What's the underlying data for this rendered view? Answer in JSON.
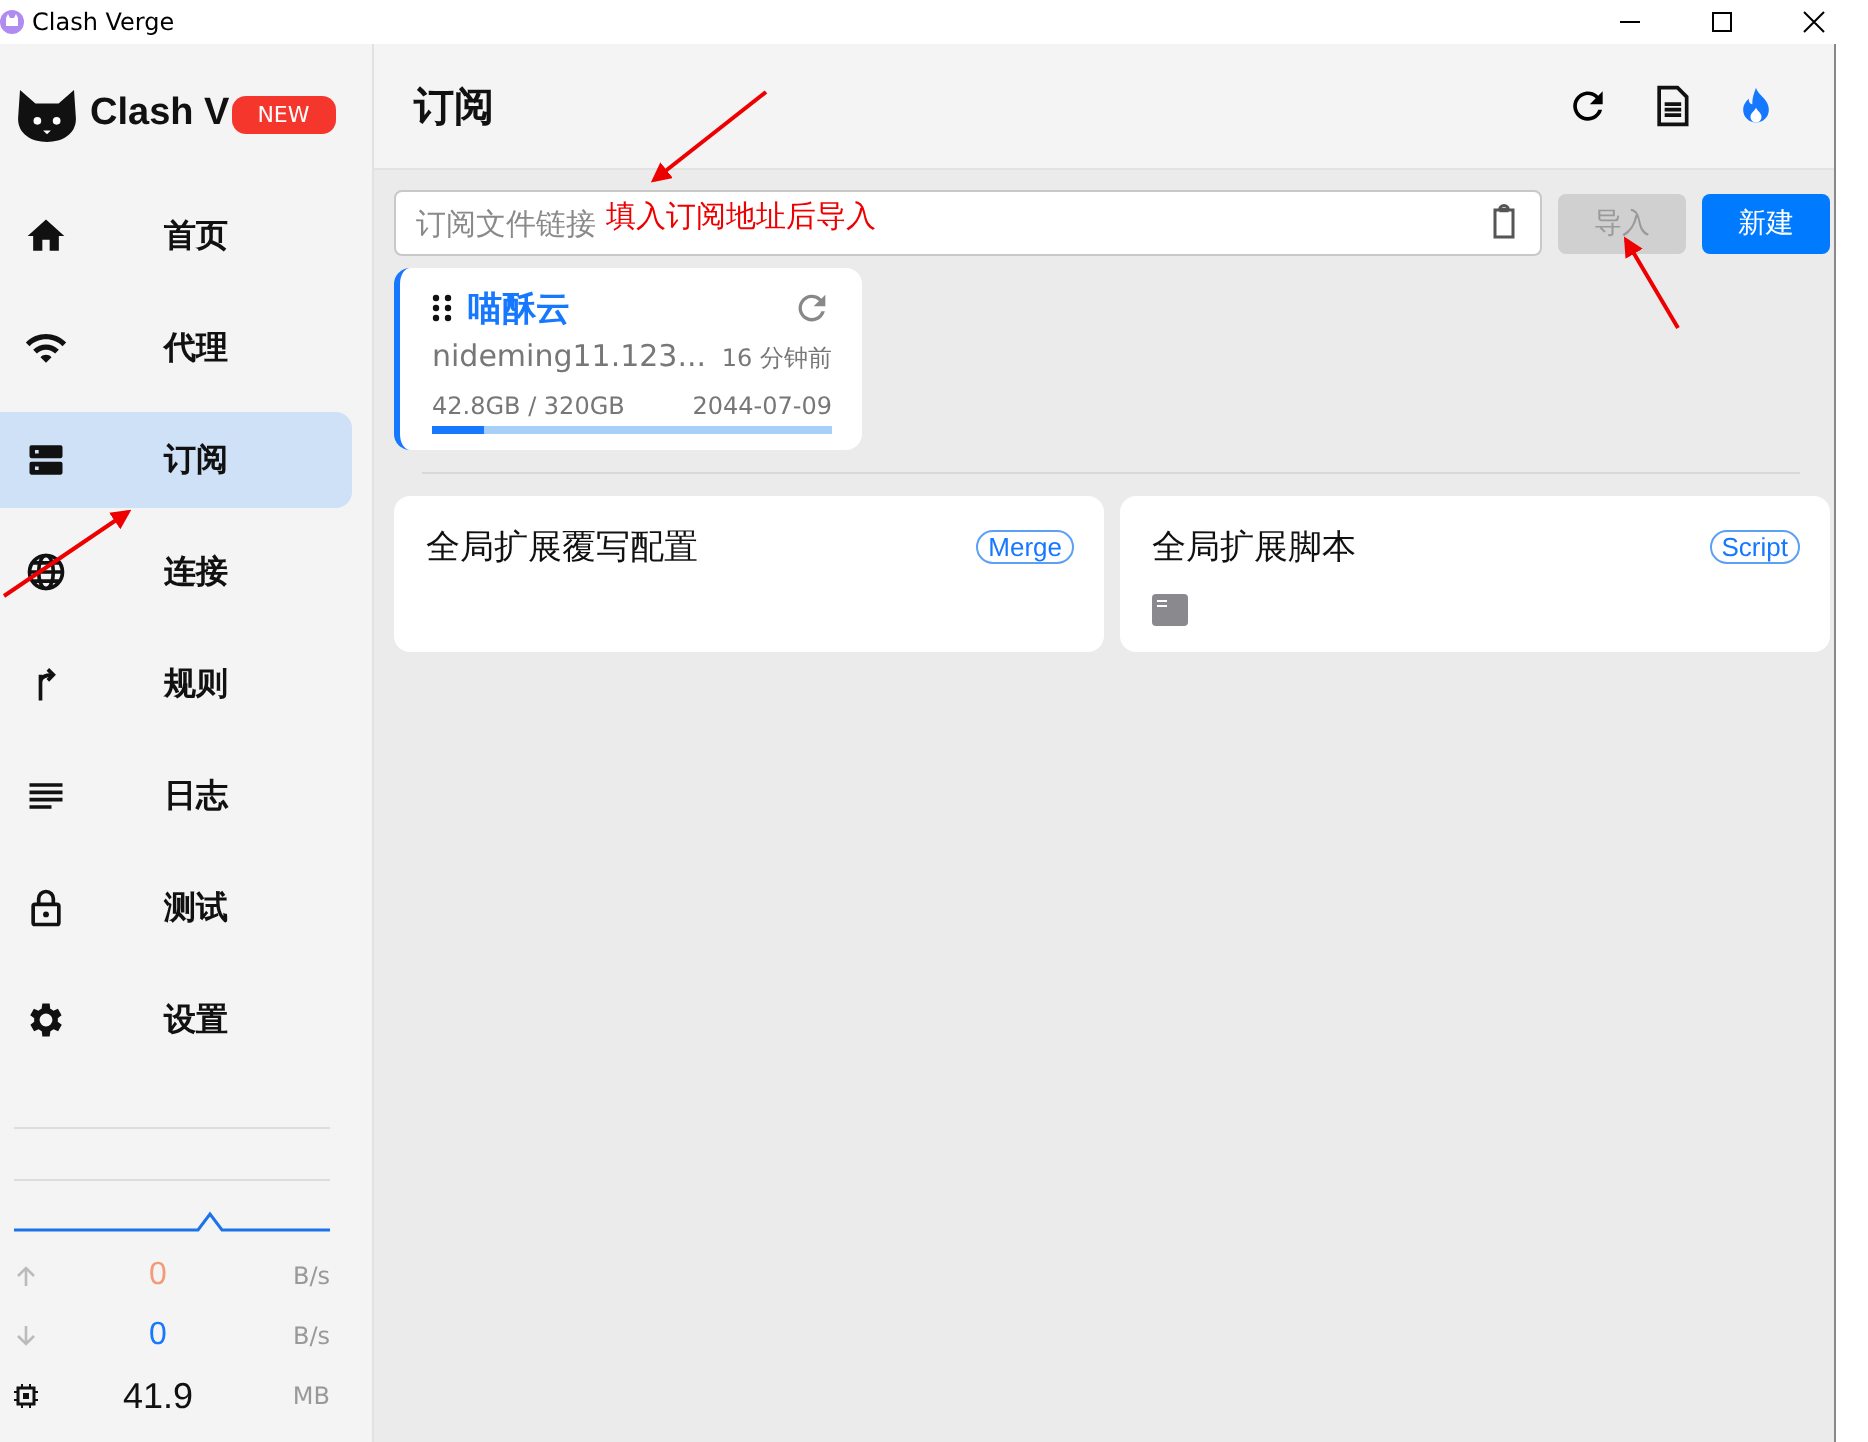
{
  "window": {
    "title": "Clash Verge"
  },
  "logo": {
    "text": "Clash V",
    "badge": "NEW"
  },
  "nav": [
    {
      "label": "首页",
      "kind": "home",
      "selected": false
    },
    {
      "label": "代理",
      "kind": "wifi",
      "selected": false
    },
    {
      "label": "订阅",
      "kind": "dns",
      "selected": true
    },
    {
      "label": "连接",
      "kind": "globe",
      "selected": false
    },
    {
      "label": "规则",
      "kind": "fork",
      "selected": false
    },
    {
      "label": "日志",
      "kind": "lines",
      "selected": false
    },
    {
      "label": "测试",
      "kind": "lock",
      "selected": false
    },
    {
      "label": "设置",
      "kind": "gear",
      "selected": false
    }
  ],
  "traffic": [
    {
      "kind": "up",
      "value": "0",
      "unit": "B/s"
    },
    {
      "kind": "down",
      "value": "0",
      "unit": "B/s"
    },
    {
      "kind": "memory",
      "value": "41.9",
      "unit": "MB"
    }
  ],
  "header": {
    "title": "订阅"
  },
  "import": {
    "placeholder": "订阅文件链接",
    "annotation": "填入订阅地址后导入",
    "import_button": {
      "label": "导入",
      "disabled": true
    },
    "new_button": "新建"
  },
  "profiles": [
    {
      "name": "喵酥云",
      "url": "nideming11.123...",
      "updated": "16 分钟前",
      "usage": "42.8GB / 320GB",
      "expire": "2044-07-09",
      "level": 0.13,
      "selected": true
    }
  ],
  "extensions": [
    {
      "title": "全局扩展覆写配置",
      "tag": "Merge",
      "kind": "merge"
    },
    {
      "title": "全局扩展脚本",
      "tag": "Script",
      "kind": "script"
    }
  ]
}
